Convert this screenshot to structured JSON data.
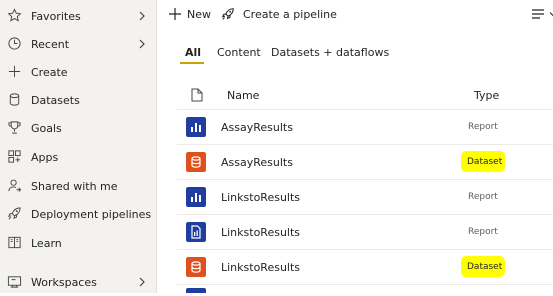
{
  "sidebar": {
    "items": [
      {
        "label": "Favorites",
        "icon": "star-icon",
        "chevron": true
      },
      {
        "label": "Recent",
        "icon": "clock-icon",
        "chevron": true
      },
      {
        "label": "Create",
        "icon": "plus-icon",
        "chevron": false
      },
      {
        "label": "Datasets",
        "icon": "database-icon",
        "chevron": false
      },
      {
        "label": "Goals",
        "icon": "trophy-icon",
        "chevron": false
      },
      {
        "label": "Apps",
        "icon": "apps-icon",
        "chevron": false
      },
      {
        "label": "Shared with me",
        "icon": "shared-user-icon",
        "chevron": false
      },
      {
        "label": "Deployment pipelines",
        "icon": "rocket-icon",
        "chevron": false
      },
      {
        "label": "Learn",
        "icon": "book-icon",
        "chevron": false
      },
      {
        "label": "Workspaces",
        "icon": "workspaces-icon",
        "chevron": true
      }
    ]
  },
  "toolbar": {
    "new_label": "New",
    "create_pipeline_label": "Create a pipeline",
    "view_icon": "list-view-icon"
  },
  "tabs": [
    {
      "label": "All",
      "active": true
    },
    {
      "label": "Content",
      "active": false
    },
    {
      "label": "Datasets + dataflows",
      "active": false
    }
  ],
  "table": {
    "headers": {
      "icon": "document-icon",
      "name": "Name",
      "type": "Type"
    },
    "rows": [
      {
        "name": "AssayResults",
        "type": "Report",
        "kind": "report",
        "highlight": false
      },
      {
        "name": "AssayResults",
        "type": "Dataset",
        "kind": "dataset",
        "highlight": true
      },
      {
        "name": "LinkstoResults",
        "type": "Report",
        "kind": "report",
        "highlight": false
      },
      {
        "name": "LinkstoResults",
        "type": "Report",
        "kind": "paginated-report",
        "highlight": false
      },
      {
        "name": "LinkstoResults",
        "type": "Dataset",
        "kind": "dataset",
        "highlight": true
      }
    ]
  },
  "colors": {
    "report": "#1f3ea0",
    "dataset": "#e0501c",
    "highlight": "#ffff00",
    "accent": "#c8a200"
  }
}
